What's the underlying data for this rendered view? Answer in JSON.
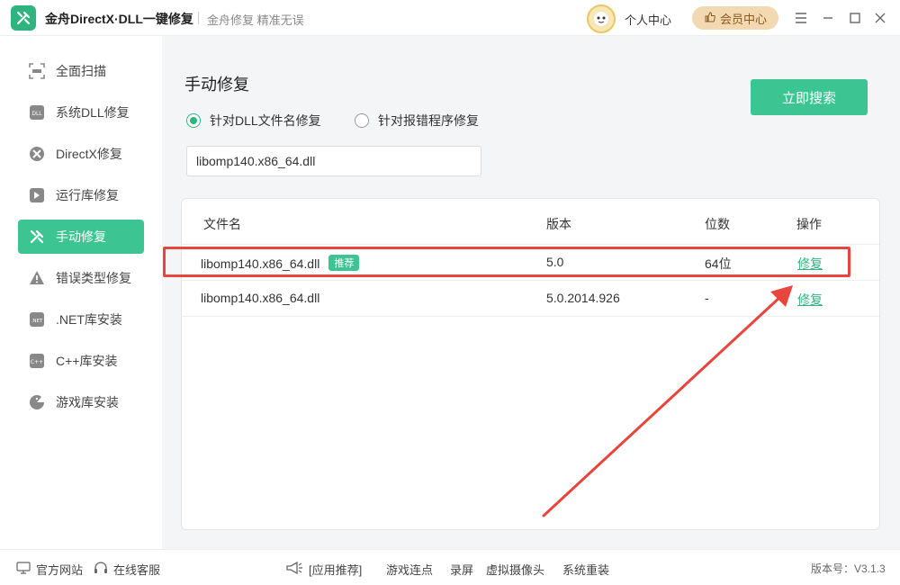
{
  "app": {
    "title": "金舟DirectX·DLL一键修复",
    "slogan": "金舟修复 精准无误",
    "personal_center": "个人中心",
    "vip_center": "会员中心"
  },
  "sidebar": {
    "items": [
      {
        "label": "全面扫描",
        "icon": "scan-icon"
      },
      {
        "label": "系统DLL修复",
        "icon": "dll-icon"
      },
      {
        "label": "DirectX修复",
        "icon": "directx-icon"
      },
      {
        "label": "运行库修复",
        "icon": "runtime-icon"
      },
      {
        "label": "手动修复",
        "icon": "wrench-icon",
        "active": true
      },
      {
        "label": "错误类型修复",
        "icon": "warning-icon"
      },
      {
        "label": ".NET库安装",
        "icon": "dotnet-icon"
      },
      {
        "label": "C++库安装",
        "icon": "cpp-icon"
      },
      {
        "label": "游戏库安装",
        "icon": "game-icon"
      }
    ]
  },
  "main": {
    "page_title": "手动修复",
    "radio_dll_label": "针对DLL文件名修复",
    "radio_error_label": "针对报错程序修复",
    "search_value": "libomp140.x86_64.dll",
    "search_button": "立即搜索",
    "table": {
      "headers": {
        "name": "文件名",
        "version": "版本",
        "bits": "位数",
        "action": "操作"
      },
      "rows": [
        {
          "name": "libomp140.x86_64.dll",
          "badge": "推荐",
          "version": "5.0",
          "bits": "64位",
          "action": "修复"
        },
        {
          "name": "libomp140.x86_64.dll",
          "badge": "",
          "version": "5.0.2014.926",
          "bits": "-",
          "action": "修复"
        }
      ]
    }
  },
  "footer": {
    "official_site": "官方网站",
    "online_service": "在线客服",
    "app_recommend": "[应用推荐]",
    "links": [
      "游戏连点",
      "录屏",
      "虚拟摄像头",
      "系统重装"
    ],
    "version": "版本号：V3.1.3"
  },
  "colors": {
    "accent": "#3cc593",
    "highlight": "#e8453c",
    "vip": "#f3d9b1"
  }
}
